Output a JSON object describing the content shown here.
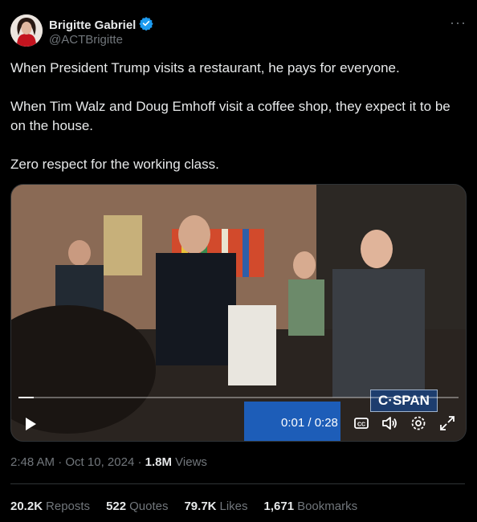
{
  "author": {
    "name": "Brigitte Gabriel",
    "handle": "@ACTBrigitte",
    "verified_color": "#1d9bf0"
  },
  "more_label": "···",
  "tweet": {
    "paragraphs": [
      "When President Trump visits a restaurant, he pays for everyone.",
      "When Tim Walz and Doug Emhoff visit a coffee shop, they expect it to be on the house.",
      "Zero respect for the working class."
    ]
  },
  "video": {
    "current_time": "0:01",
    "duration": "0:28",
    "time_display": "0:01 / 0:28",
    "progress_fraction": 0.035,
    "watermark": "C·SPAN"
  },
  "meta": {
    "time": "2:48 AM",
    "date": "Oct 10, 2024",
    "views_count": "1.8M",
    "views_label": "Views"
  },
  "stats": [
    {
      "count": "20.2K",
      "label": "Reposts"
    },
    {
      "count": "522",
      "label": "Quotes"
    },
    {
      "count": "79.7K",
      "label": "Likes"
    },
    {
      "count": "1,671",
      "label": "Bookmarks"
    }
  ],
  "colors": {
    "background": "#000000",
    "text_primary": "#e7e9ea",
    "text_secondary": "#71767b",
    "border": "#2f3336"
  }
}
